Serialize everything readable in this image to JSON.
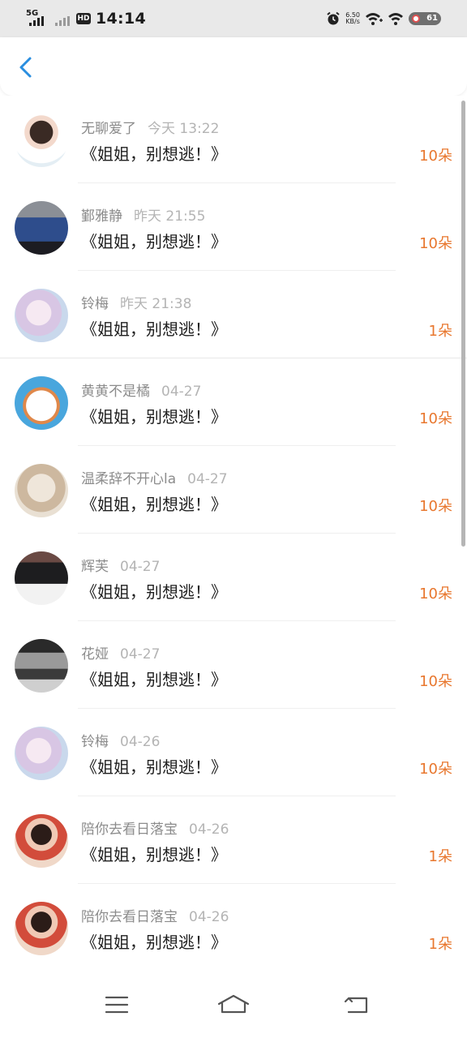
{
  "status_bar": {
    "network": "5G",
    "hd": "HD",
    "time": "14:14",
    "net_speed_value": "6.50",
    "net_speed_unit": "KB/s",
    "battery": "61"
  },
  "header": {
    "back_icon": "chevron-left-icon"
  },
  "colors": {
    "accent_blue": "#2a8ee0",
    "amount_orange": "#e8772e",
    "muted_text": "#8c8c8c"
  },
  "list": [
    {
      "name": "无聊爱了",
      "time": "今天 13:22",
      "message": "《姐姐，别想逃！》",
      "amount": "10朵",
      "avatar": "avatar-girl-white"
    },
    {
      "name": "鄞雅静",
      "time": "昨天 21:55",
      "message": "《姐姐，别想逃！》",
      "amount": "10朵",
      "avatar": "avatar-blue-car"
    },
    {
      "name": "铃梅",
      "time": "昨天 21:38",
      "message": "《姐姐，别想逃！》",
      "amount": "1朵",
      "avatar": "avatar-anime-pastel"
    },
    {
      "name": "黄黄不是橘",
      "time": "04-27",
      "message": "《姐姐，别想逃！》",
      "amount": "10朵",
      "avatar": "avatar-hamster-cartoon"
    },
    {
      "name": "温柔辞不开心la",
      "time": "04-27",
      "message": "《姐姐，别想逃！》",
      "amount": "10朵",
      "avatar": "avatar-anime-beige"
    },
    {
      "name": "辉芙",
      "time": "04-27",
      "message": "《姐姐，别想逃！》",
      "amount": "10朵",
      "avatar": "avatar-boy-dark"
    },
    {
      "name": "花娅",
      "time": "04-27",
      "message": "《姐姐，别想逃！》",
      "amount": "10朵",
      "avatar": "avatar-railway-bw"
    },
    {
      "name": "铃梅",
      "time": "04-26",
      "message": "《姐姐，别想逃！》",
      "amount": "10朵",
      "avatar": "avatar-anime-pastel"
    },
    {
      "name": "陪你去看日落宝",
      "time": "04-26",
      "message": "《姐姐，别想逃！》",
      "amount": "1朵",
      "avatar": "avatar-boy-red"
    },
    {
      "name": "陪你去看日落宝",
      "time": "04-26",
      "message": "《姐姐，别想逃！》",
      "amount": "1朵",
      "avatar": "avatar-boy-red"
    }
  ],
  "nav_bar": {
    "menu_icon": "menu-icon",
    "home_icon": "home-icon",
    "back_icon": "back-icon"
  }
}
